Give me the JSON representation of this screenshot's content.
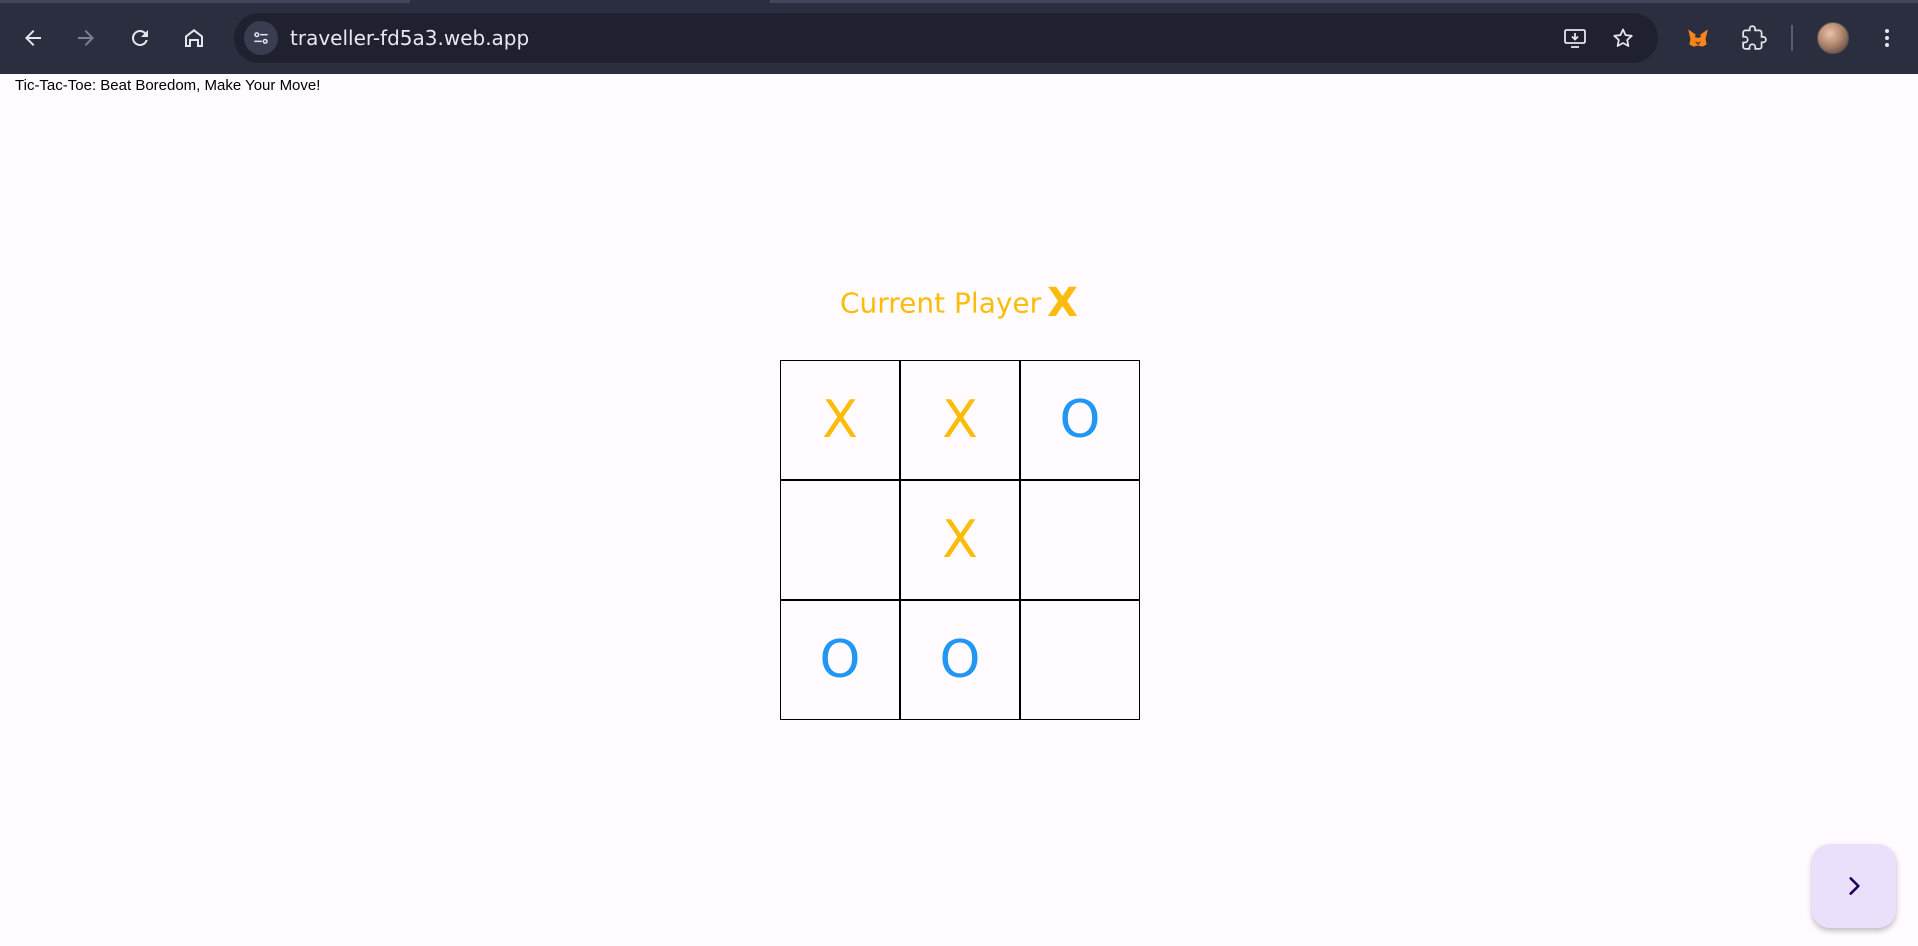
{
  "browser": {
    "url": "traveller-fd5a3.web.app",
    "icons": {
      "back": "arrow-left-icon",
      "forward": "arrow-right-icon",
      "reload": "reload-icon",
      "home": "home-icon",
      "site_info": "tune-icon",
      "install": "install-app-icon",
      "bookmark": "star-icon",
      "extension_fox": "metamask-fox-icon",
      "extensions": "puzzle-icon",
      "menu": "kebab-menu-icon"
    }
  },
  "page": {
    "title": "Tic-Tac-Toe: Beat Boredom, Make Your Move!",
    "status_label": "Current Player",
    "current_player": "X"
  },
  "board": {
    "cells": [
      "X",
      "X",
      "O",
      "",
      "X",
      "",
      "O",
      "O",
      ""
    ]
  },
  "colors": {
    "x_mark": "#fbbc0b",
    "o_mark": "#2196f3",
    "background": "#fffbff",
    "fab_background": "#ebe0fb",
    "browser_toolbar": "#2b2e3f"
  },
  "fab": {
    "icon": "chevron-right-icon"
  }
}
